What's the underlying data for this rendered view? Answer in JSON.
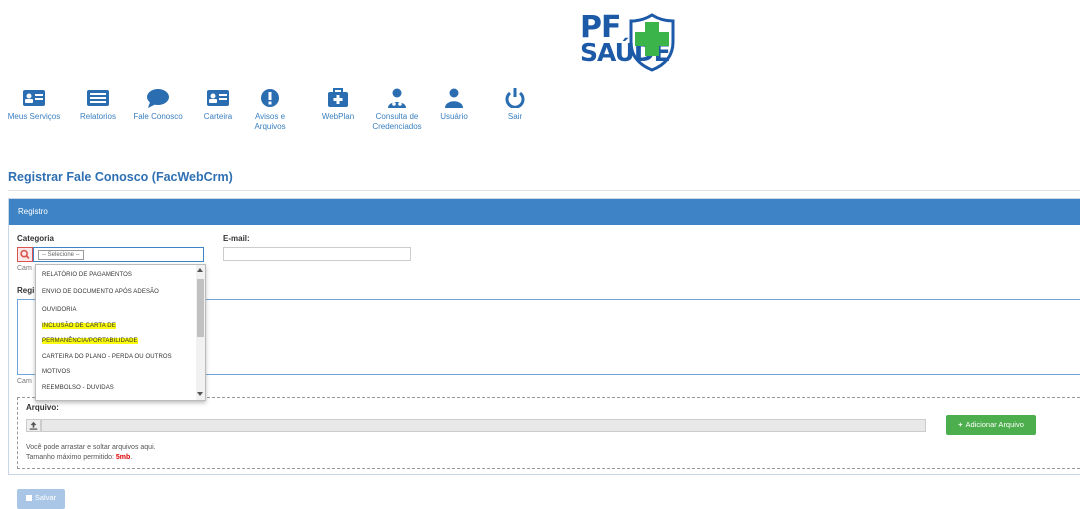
{
  "logo": {
    "line1": "PF",
    "line2": "SAÚDE"
  },
  "nav": [
    {
      "label": "Meus Serviços",
      "icon": "id-card-icon"
    },
    {
      "label": "Relatorios",
      "icon": "list-icon"
    },
    {
      "label": "Fale Conosco",
      "icon": "chat-bubble-icon"
    },
    {
      "label": "Carteira",
      "icon": "id-card-icon"
    },
    {
      "label": "Avisos e Arquivos",
      "icon": "exclamation-icon"
    },
    {
      "label": "WebPlan",
      "icon": "medkit-icon"
    },
    {
      "label": "Consulta de Credenciados",
      "icon": "doctor-icon"
    },
    {
      "label": "Usuário",
      "icon": "user-icon"
    },
    {
      "label": "Sair",
      "icon": "power-icon"
    }
  ],
  "page": {
    "title": "Registrar Fale Conosco (FacWebCrm)"
  },
  "panel": {
    "heading": "Registro"
  },
  "form": {
    "categoria_label": "Categoria",
    "categoria_placeholder": "-- Selecione --",
    "help_cut_1": "Cam",
    "registro_label_cut": "Regi",
    "help_cut_2": "Cam",
    "email_label": "E-mail:",
    "email_value": ""
  },
  "dropdown": {
    "options": [
      "RELATÓRIO DE PAGAMENTOS",
      "ENVIO DE DOCUMENTO APÓS ADESÃO",
      "OUVIDORIA",
      "INCLUSÃO DE CARTA DE PERMANÊNCIA/PORTABILIDADE",
      "CARTEIRA DO PLANO - PERDA OU OUTROS MOTIVOS",
      "REEMBOLSO - DUVIDAS"
    ],
    "highlighted_option": "INCLUSÃO DE CARTA DE PERMANÊNCIA/PORTABILIDADE",
    "highlight_color": "#fbfb0f"
  },
  "files": {
    "label": "Arquivo:",
    "add_button": "Adicionar Arquivo",
    "drag_hint": "Você pode arrastar e soltar arquivos aqui.",
    "max_size_label": "Tamanho máximo permitido:",
    "max_size_value": "5mb"
  },
  "actions": {
    "save": "Salvar"
  },
  "colors": {
    "primary": "#3d83c6",
    "success": "#4cae4c",
    "brand_blue": "#1c5aa8",
    "brand_green": "#3bb44a"
  }
}
